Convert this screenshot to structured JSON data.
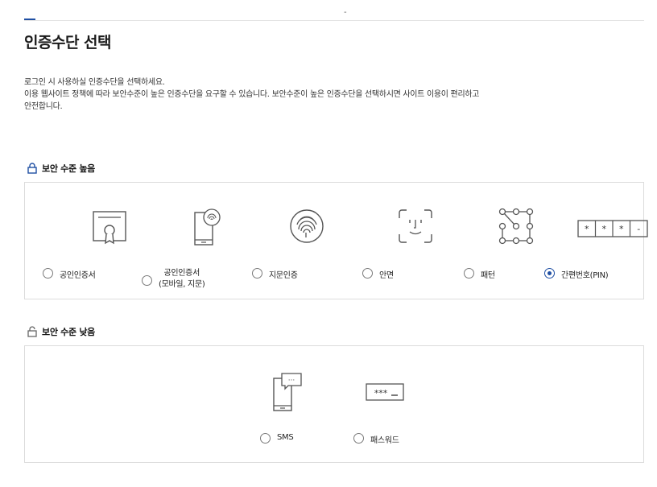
{
  "page": {
    "top_dash": "-",
    "title": "인증수단 선택",
    "description": [
      "로그인 시 사용하실 인증수단을 선택하세요.",
      "이용 웹사이트 정책에 따라 보안수준이 높은 인증수단을 요구할 수 있습니다. 보안수준이 높은 인증수단을 선택하시면 사이트 이용이 편리하고",
      "안전합니다."
    ]
  },
  "high_security": {
    "title": "보안 수준 높음",
    "options": [
      {
        "label": "공인인증서",
        "icon": "certificate-icon",
        "checked": false
      },
      {
        "label_line1": "공인인증서",
        "label_line2": "(모바일, 지문)",
        "icon": "mobile-certificate-icon",
        "checked": false
      },
      {
        "label": "지문인증",
        "icon": "fingerprint-icon",
        "checked": false
      },
      {
        "label": "안면",
        "icon": "face-id-icon",
        "checked": false
      },
      {
        "label": "패턴",
        "icon": "pattern-icon",
        "checked": false
      },
      {
        "label": "간편번호(PIN)",
        "icon": "pin-icon",
        "checked": true
      }
    ]
  },
  "low_security": {
    "title": "보안 수준 낮음",
    "options": [
      {
        "label": "SMS",
        "icon": "sms-icon",
        "checked": false
      },
      {
        "label": "패스워드",
        "icon": "password-icon",
        "checked": false
      }
    ]
  },
  "icon_text": {
    "pin_star": "*",
    "pin_dash": "-",
    "password_dots": "***",
    "sms_dots": "···"
  },
  "colors": {
    "accent": "#1f4fa3",
    "border": "#dcdcdc",
    "icon_stroke": "#555555"
  }
}
